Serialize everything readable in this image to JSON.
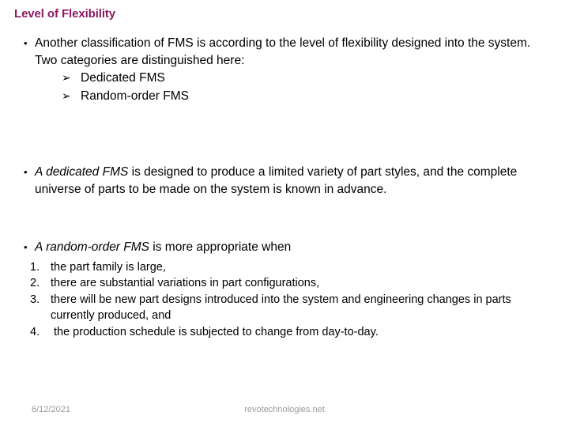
{
  "slide": {
    "title": "Level of Flexibility",
    "title_color": "#8B1A62",
    "background_color": "#ffffff",
    "text_color": "#000000"
  },
  "markers": {
    "bullet": "•",
    "sub_arrow": "➢"
  },
  "content": {
    "bullet1": {
      "text_before_italic": "",
      "text": "Another classification of FMS is according to the level of flexibility designed into the system. Two categories are distinguished here:",
      "sub_items": [
        {
          "label": "Dedicated FMS"
        },
        {
          "label": "Random-order FMS"
        }
      ]
    },
    "bullet2": {
      "italic_lead": "A dedicated FMS",
      "rest": " is designed to produce a limited variety of part styles, and the complete universe of parts to be made on the system is known in advance."
    },
    "bullet3": {
      "italic_lead": "A random-order FMS",
      "rest": " is more appropriate when",
      "numbered_items": [
        {
          "number": "1.",
          "label": "the part family is large,"
        },
        {
          "number": "2.",
          "label": "there are substantial variations in part configurations,"
        },
        {
          "number": "3.",
          "label": "there will be new part designs introduced into the system and engineering changes in parts currently produced, and"
        },
        {
          "number": "4.",
          "label": "the production schedule is subjected to change from day-to-day."
        }
      ]
    }
  },
  "footer": {
    "date": "6/12/2021",
    "source": "revotechnologies.net",
    "color": "#9a9a9a"
  }
}
